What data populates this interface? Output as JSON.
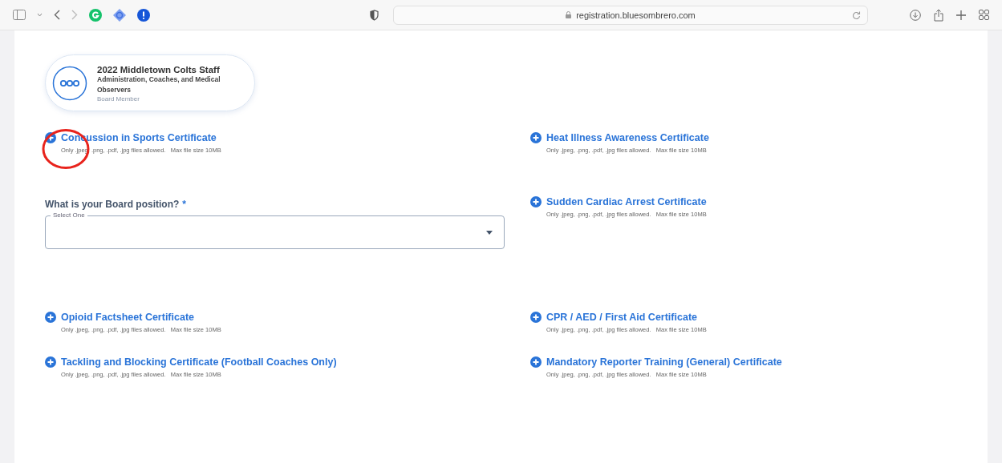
{
  "browser": {
    "url": "registration.bluesombrero.com"
  },
  "program_card": {
    "title": "2022 Middletown Colts Staff",
    "subtitle": "Administration, Coaches, and Medical Observers",
    "role": "Board Member"
  },
  "left_column": [
    {
      "kind": "certificate",
      "title": "Concussion in Sports Certificate",
      "hint": "Only .jpeg, .png, .pdf, .jpg files allowed.   Max file size 10MB"
    },
    {
      "kind": "select",
      "label": "What is your Board position?",
      "required_mark": "*",
      "floating_label": "Select One"
    },
    {
      "kind": "certificate",
      "title": "Opioid Factsheet Certificate",
      "hint": "Only .jpeg, .png, .pdf, .jpg files allowed.   Max file size 10MB"
    },
    {
      "kind": "certificate",
      "title": "Tackling and Blocking Certificate (Football Coaches Only)",
      "hint": "Only .jpeg, .png, .pdf, .jpg files allowed.   Max file size 10MB"
    }
  ],
  "right_column": [
    {
      "kind": "certificate",
      "title": "Heat Illness Awareness Certificate",
      "hint": "Only .jpeg, .png, .pdf, .jpg files allowed.   Max file size 10MB"
    },
    {
      "kind": "certificate",
      "title": "Sudden Cardiac Arrest Certificate",
      "hint": "Only .jpeg, .png, .pdf, .jpg files allowed.   Max file size 10MB"
    },
    {
      "kind": "certificate",
      "title": "CPR / AED / First Aid Certificate",
      "hint": "Only .jpeg, .png, .pdf, .jpg files allowed.   Max file size 10MB"
    },
    {
      "kind": "certificate",
      "title": "Mandatory Reporter Training (General) Certificate",
      "hint": "Only .jpeg, .png, .pdf, .jpg files allowed.   Max file size 10MB"
    }
  ]
}
